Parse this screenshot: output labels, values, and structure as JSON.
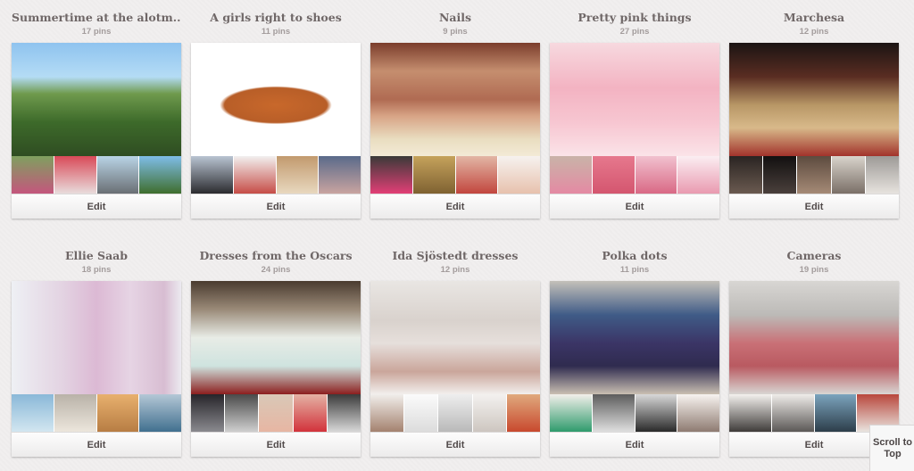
{
  "boards": [
    {
      "title": "Summertime at the alotm...",
      "count": "17 pins",
      "edit": "Edit",
      "cover": "linear-gradient(180deg,#8fc3ef 0%,#b4dcf5 30%,#6f9a4d 45%,#3d6a2a 70%,#2f4d22 100%)",
      "thumbs": [
        "linear-gradient(#7fa05f,#c4567d)",
        "linear-gradient(#d94a58,#e8dcdc)",
        "linear-gradient(#b9d4e6,#6a6f74)",
        "linear-gradient(#7fbde8,#3f6e2e)"
      ]
    },
    {
      "title": "A girls right to shoes",
      "count": "11 pins",
      "edit": "Edit",
      "cover": "radial-gradient(ellipse 55% 28% at 50% 55%,#c8682b 0%,#b85e28 55%,#ffffff 60%)",
      "thumbs": [
        "linear-gradient(#b9c4d2,#2b2b2f)",
        "linear-gradient(#f2f0ef,#c64d47)",
        "linear-gradient(#c29a6e,#e8d8bf)",
        "linear-gradient(#5a6a8a,#c9a4a0)"
      ]
    },
    {
      "title": "Nails",
      "count": "9 pins",
      "edit": "Edit",
      "cover": "linear-gradient(180deg,#7b3d2c 0%,#c58e6f 25%,#b06b52 50%,#d8a587 65%,#e9ddc0 85%,#f3ead6 100%)",
      "thumbs": [
        "linear-gradient(#3a3a38,#e23f76)",
        "linear-gradient(#c5a25b,#7f6232)",
        "linear-gradient(#e2b6a5,#c2463e)",
        "linear-gradient(#f6f2ef,#e7c1ad)"
      ]
    },
    {
      "title": "Pretty pink things",
      "count": "27 pins",
      "edit": "Edit",
      "cover": "linear-gradient(180deg,#f7d9df 0%,#f3b3c2 40%,#f7c6d1 70%,#fbe3e8 100%)",
      "thumbs": [
        "linear-gradient(#c9b3a8,#e48aa3)",
        "linear-gradient(#e6788d,#d4566f)",
        "linear-gradient(#f1c1cf,#d96985)",
        "linear-gradient(#fbeef2,#e99ab0)"
      ]
    },
    {
      "title": "Marchesa",
      "count": "12 pins",
      "edit": "Edit",
      "cover": "linear-gradient(180deg,#1b1413 0%,#5a2d22 30%,#b89766 55%,#d8b98a 75%,#a2332b 100%)",
      "thumbs": [
        "linear-gradient(#2a2422,#6a5a50)",
        "linear-gradient(#121010,#4a403c)",
        "linear-gradient(#5d4b3f,#a58a76)",
        "linear-gradient(#d9d4cc,#7a6f67)",
        "linear-gradient(#9d9a97,#e7e3de)"
      ]
    },
    {
      "title": "Ellie Saab",
      "count": "18 pins",
      "edit": "Edit",
      "cover": "linear-gradient(90deg,#eef0f4 0%,#e3d3e2 30%,#dcb9d4 50%,#e6d4e4 70%,#d8bdd2 90%,#eceaf0 100%)",
      "thumbs": [
        "linear-gradient(#8ab8d8,#d2e6f0)",
        "linear-gradient(#b9b2a8,#ece6dc)",
        "linear-gradient(#e8b06e,#b77d44)",
        "linear-gradient(#b4c7d6,#41708f)"
      ]
    },
    {
      "title": "Dresses from the Oscars",
      "count": "24 pins",
      "edit": "Edit",
      "cover": "linear-gradient(180deg,#4a3b2f 0%,#9a8a78 25%,#e8ece6 50%,#cfe3df 75%,#8c1f1f 100%)",
      "thumbs": [
        "linear-gradient(#27252a,#8a8a8f)",
        "linear-gradient(#4a4a4a,#cfcfcf)",
        "linear-gradient(#d9c8b7,#e7b6a3)",
        "linear-gradient(#e4b2a4,#d2323b)",
        "linear-gradient(#3b3b3b,#d8d8d8)"
      ]
    },
    {
      "title": "Ida Sjöstedt dresses",
      "count": "12 pins",
      "edit": "Edit",
      "cover": "linear-gradient(180deg,#e9e6e3 0%,#d9d2cd 35%,#e6dfdb 55%,#caa69b 80%,#f2efed 100%)",
      "thumbs": [
        "linear-gradient(#f1eeeb,#a4826f)",
        "linear-gradient(#fbfbfb,#dcdcdc)",
        "linear-gradient(#eeeeee,#b9b9b9)",
        "linear-gradient(#f3f1ef,#cdc6c0)",
        "linear-gradient(#e0a97d,#c8492e)"
      ]
    },
    {
      "title": "Polka dots",
      "count": "11 pins",
      "edit": "Edit",
      "cover": "linear-gradient(180deg,#c4c0b9 0%,#3f5b87 30%,#3b3566 55%,#2f2b4f 75%,#c9bfb2 100%)",
      "thumbs": [
        "linear-gradient(#f3efea,#2f9b6c)",
        "linear-gradient(#5d5d5d,#dfdfdf)",
        "linear-gradient(#d8d8d8,#2a2a2a)",
        "linear-gradient(#f7f3f0,#8e7b71)"
      ]
    },
    {
      "title": "Cameras",
      "count": "19 pins",
      "edit": "Edit",
      "cover": "linear-gradient(180deg,#d8d6d3 0%,#bcbab7 30%,#c97076 55%,#b95a61 75%,#d8d6d3 100%)",
      "thumbs": [
        "linear-gradient(#f4f1ee,#3f3c3a)",
        "linear-gradient(#efece9,#5b5856)",
        "linear-gradient(#7ba3bd,#2d3e4a)",
        "linear-gradient(#b8473c,#e9e4df)"
      ]
    }
  ],
  "scroll_top": "Scroll to Top"
}
